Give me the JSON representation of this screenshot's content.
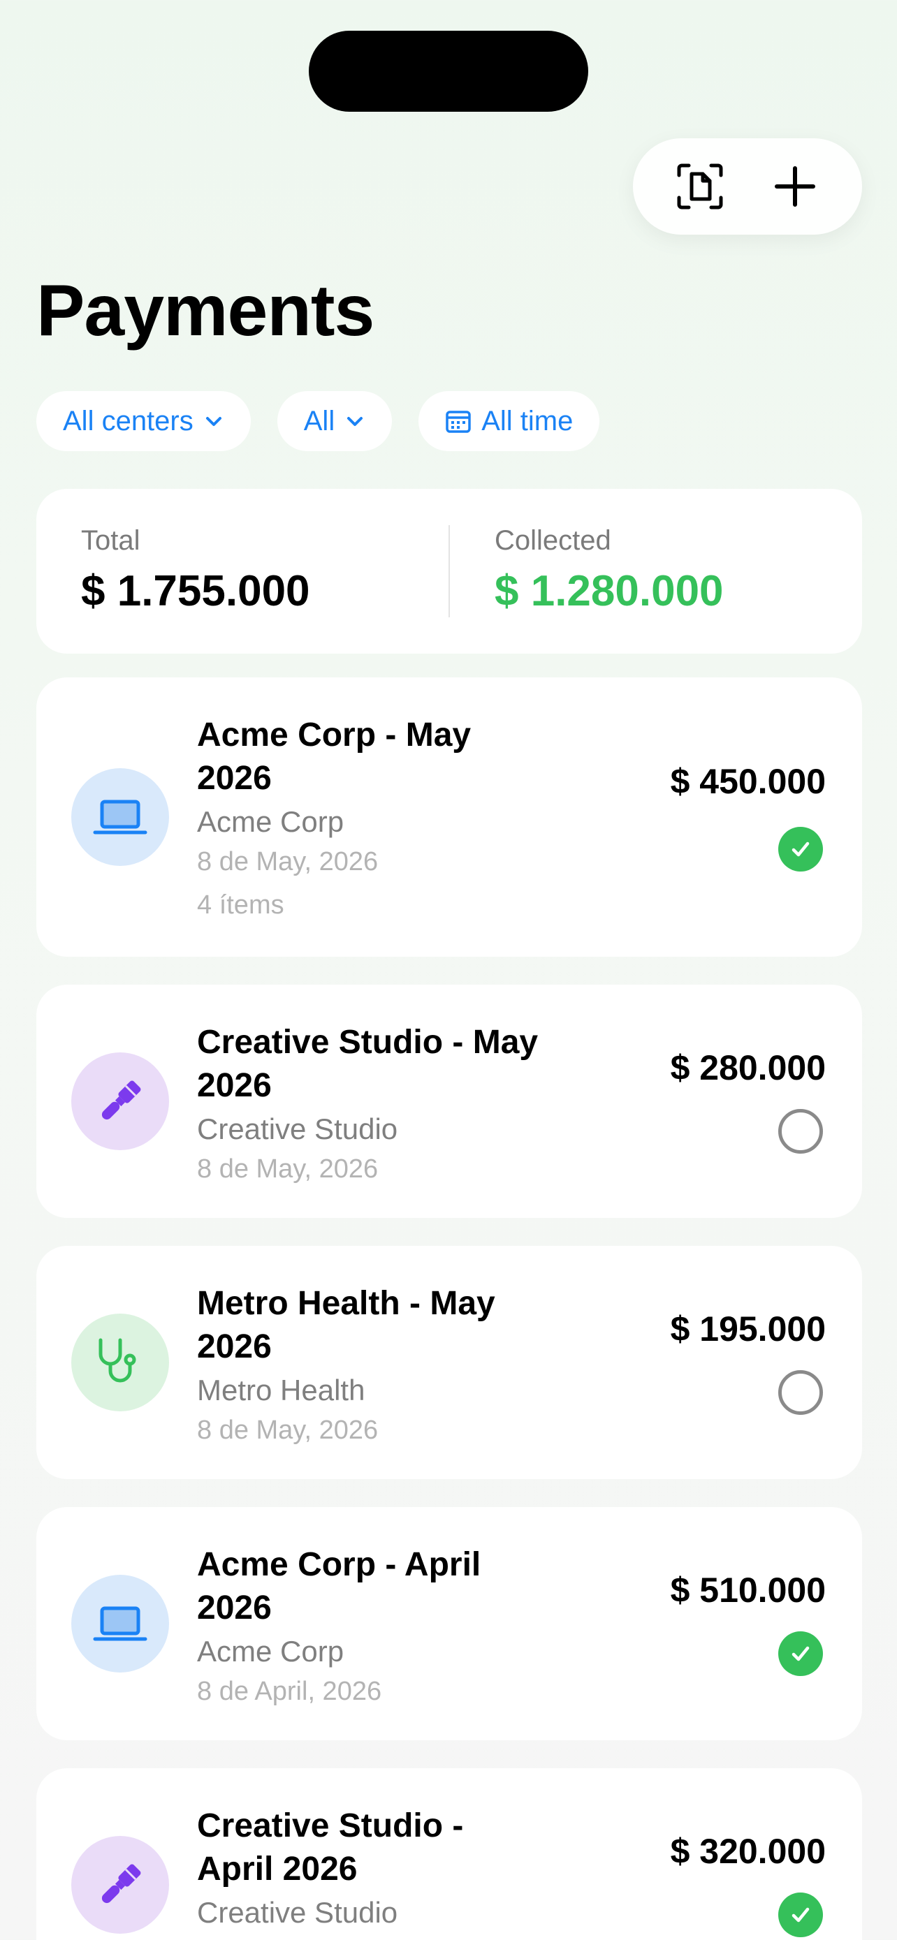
{
  "header": {
    "title": "Payments",
    "actions": [
      {
        "icon": "scan-document-icon"
      },
      {
        "icon": "plus-icon"
      }
    ]
  },
  "filters": {
    "center": "All centers",
    "status": "All",
    "period": "All time"
  },
  "summary": {
    "total_label": "Total",
    "total_value": "$ 1.755.000",
    "collected_label": "Collected",
    "collected_value": "$ 1.280.000"
  },
  "colors": {
    "accent": "#1a82f5",
    "paid_green": "#35c05a",
    "tech_bg": "#d9e9fb",
    "tech_icon": "#1a82f5",
    "creative_bg": "#eadcf8",
    "creative_icon": "#7c3aed",
    "health_bg": "#dcf3e0",
    "health_icon": "#35c05a"
  },
  "payments": [
    {
      "title": "Acme Corp - May 2026",
      "client": "Acme Corp",
      "date": "8 de May, 2026",
      "items": "4 ítems",
      "amount": "$ 450.000",
      "status": "paid",
      "icon": "laptop-icon"
    },
    {
      "title": "Creative Studio - May 2026",
      "client": "Creative Studio",
      "date": "8 de May, 2026",
      "amount": "$ 280.000",
      "status": "unpaid",
      "icon": "paintbrush-icon"
    },
    {
      "title": "Metro Health - May 2026",
      "client": "Metro Health",
      "date": "8 de May, 2026",
      "amount": "$ 195.000",
      "status": "unpaid",
      "icon": "stethoscope-icon"
    },
    {
      "title": "Acme Corp - April 2026",
      "client": "Acme Corp",
      "date": "8 de April, 2026",
      "amount": "$ 510.000",
      "status": "paid",
      "icon": "laptop-icon"
    },
    {
      "title": "Creative Studio - April 2026",
      "client": "Creative Studio",
      "amount": "$ 320.000",
      "status": "paid",
      "icon": "paintbrush-icon"
    }
  ]
}
